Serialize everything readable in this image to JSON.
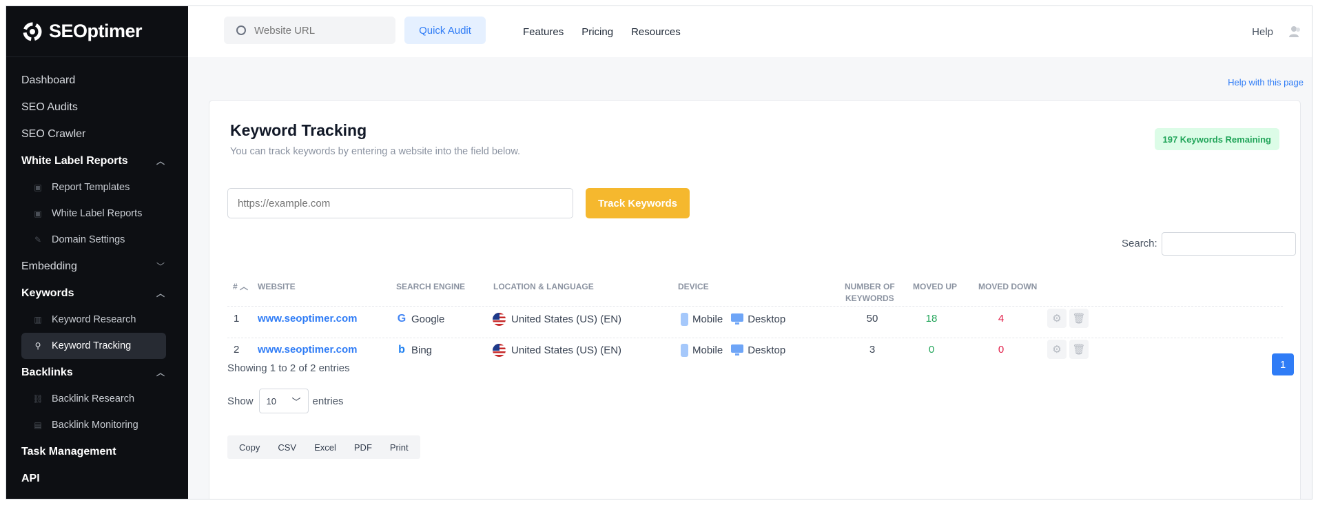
{
  "brand": {
    "name": "SEOptimer"
  },
  "sidebar": {
    "items": [
      {
        "label": "Dashboard"
      },
      {
        "label": "SEO Audits"
      },
      {
        "label": "SEO Crawler"
      },
      {
        "label": "White Label Reports",
        "expanded": true,
        "children": [
          {
            "label": "Report Templates"
          },
          {
            "label": "White Label Reports"
          },
          {
            "label": "Domain Settings"
          }
        ]
      },
      {
        "label": "Embedding",
        "expanded": false
      },
      {
        "label": "Keywords",
        "expanded": true,
        "children": [
          {
            "label": "Keyword Research"
          },
          {
            "label": "Keyword Tracking",
            "active": true
          }
        ]
      },
      {
        "label": "Backlinks",
        "expanded": true,
        "children": [
          {
            "label": "Backlink Research"
          },
          {
            "label": "Backlink Monitoring"
          }
        ]
      },
      {
        "label": "Task Management"
      },
      {
        "label": "API"
      }
    ]
  },
  "topbar": {
    "search_placeholder": "Website URL",
    "quick_audit": "Quick Audit",
    "nav": [
      "Features",
      "Pricing",
      "Resources"
    ],
    "help": "Help"
  },
  "page": {
    "help_link": "Help with this page",
    "title": "Keyword Tracking",
    "subtitle": "You can track keywords by entering a website into the field below.",
    "remaining_badge": "197 Keywords Remaining",
    "url_placeholder": "https://example.com",
    "track_button": "Track Keywords",
    "search_label": "Search:"
  },
  "table": {
    "headers": {
      "num": "#",
      "website": "WEBSITE",
      "engine": "SEARCH ENGINE",
      "location": "LOCATION & LANGUAGE",
      "device": "DEVICE",
      "keywords_1": "NUMBER OF",
      "keywords_2": "KEYWORDS",
      "moved_up": "MOVED UP",
      "moved_down": "MOVED DOWN"
    },
    "rows": [
      {
        "num": "1",
        "website": "www.seoptimer.com",
        "engine": "Google",
        "location": "United States (US) (EN)",
        "device_mobile": "Mobile",
        "device_desktop": "Desktop",
        "keywords": "50",
        "moved_up": "18",
        "moved_down": "4"
      },
      {
        "num": "2",
        "website": "www.seoptimer.com",
        "engine": "Bing",
        "location": "United States (US) (EN)",
        "device_mobile": "Mobile",
        "device_desktop": "Desktop",
        "keywords": "3",
        "moved_up": "0",
        "moved_down": "0"
      }
    ]
  },
  "footer": {
    "showing": "Showing 1 to 2 of 2 entries",
    "page": "1",
    "show": "Show",
    "page_size": "10",
    "entries": "entries",
    "export": [
      "Copy",
      "CSV",
      "Excel",
      "PDF",
      "Print"
    ]
  },
  "colors": {
    "accent": "#2f7cf6",
    "track_button": "#f5b82e",
    "positive": "#22a55a",
    "negative": "#e11d48",
    "sidebar_bg": "#0d0f13"
  }
}
